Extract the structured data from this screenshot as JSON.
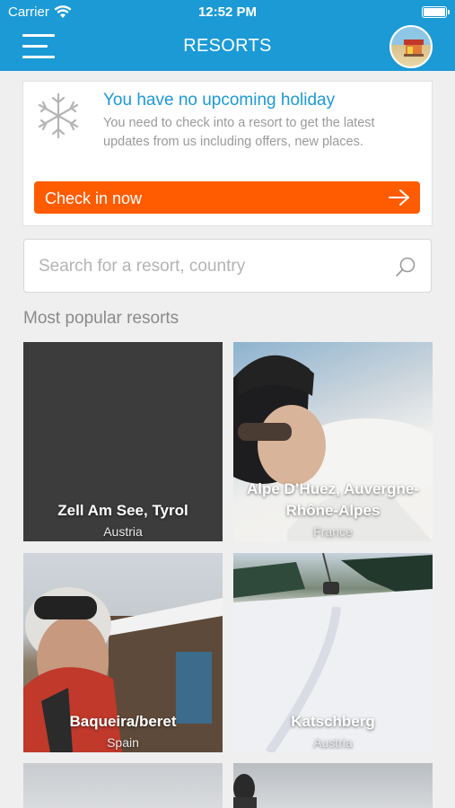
{
  "status_bar": {
    "carrier": "Carrier",
    "time": "12:52 PM"
  },
  "nav": {
    "title": "RESORTS"
  },
  "holiday": {
    "title": "You have no upcoming holiday",
    "text": "You need to check into a resort to get the latest updates from us including offers, new places.",
    "button_label": "Check in now"
  },
  "search": {
    "placeholder": "Search for a resort, country",
    "value": ""
  },
  "section_title": "Most popular resorts",
  "resorts": [
    {
      "name": "Zell Am See, Tyrol",
      "country": "Austria"
    },
    {
      "name": "Alpe D’Huez, Auvergne-Rhône-Alpes",
      "country": "France"
    },
    {
      "name": "Baqueira/beret",
      "country": "Spain"
    },
    {
      "name": "Katschberg",
      "country": "Austria"
    }
  ],
  "colors": {
    "primary": "#1b9ad6",
    "accent": "#ff5b00",
    "background": "#efeff0"
  }
}
